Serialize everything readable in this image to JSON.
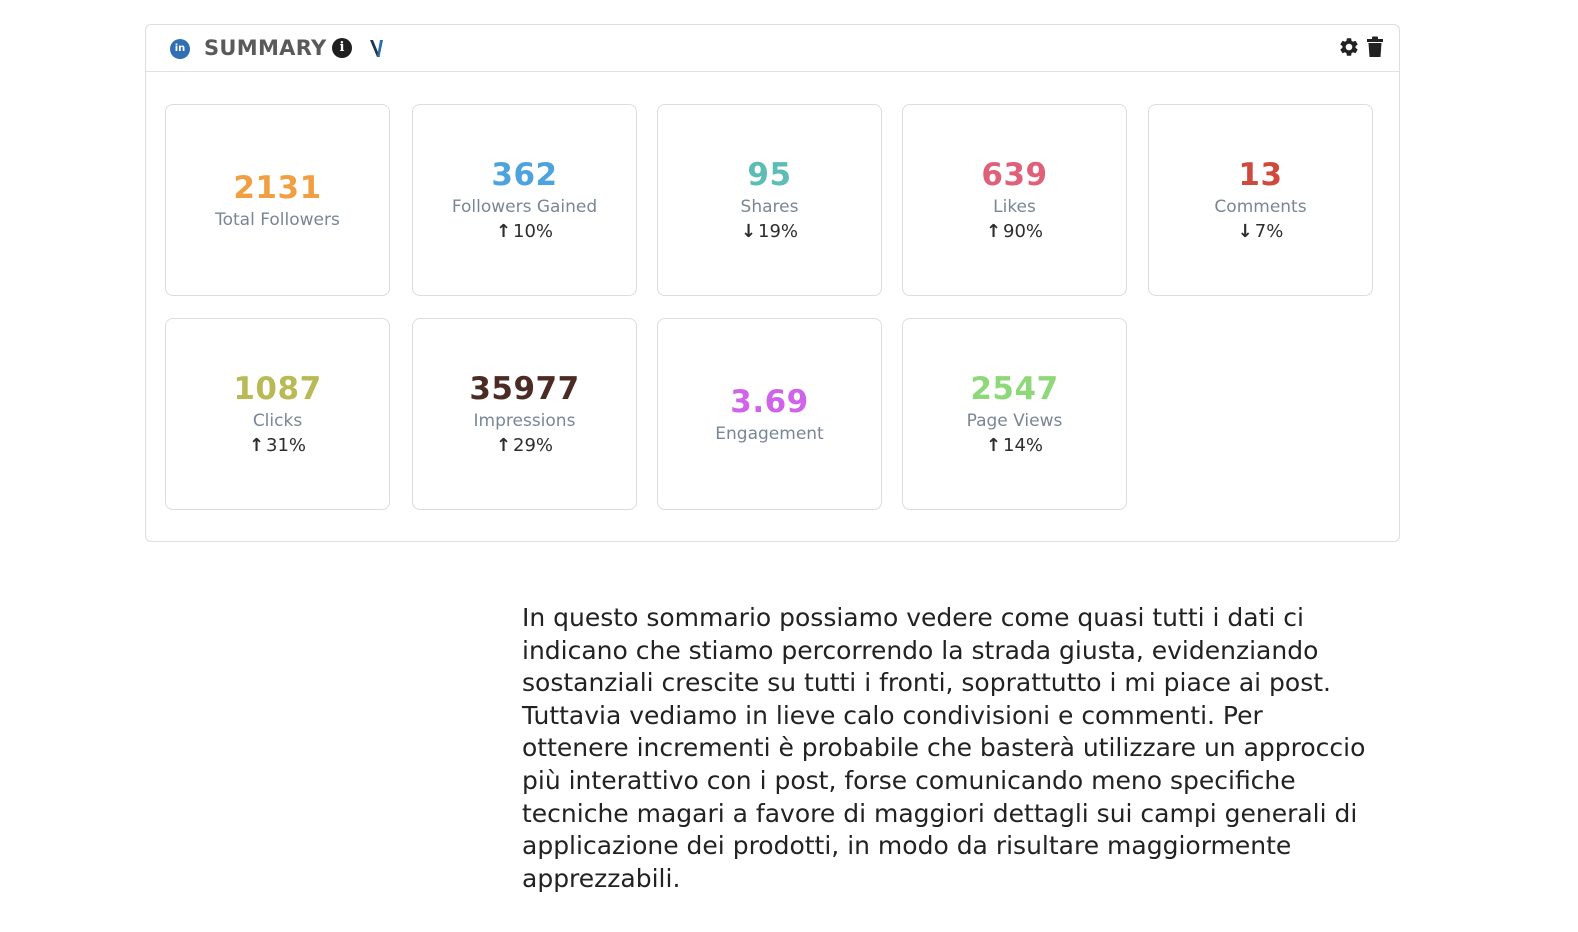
{
  "widget": {
    "network_badge": "in",
    "title": "SUMMARY",
    "info_glyph": "i",
    "icons": [
      "linkedin-icon",
      "info-icon",
      "v-logo-icon",
      "gear-icon",
      "trash-icon"
    ]
  },
  "colors": {
    "total_followers": "#f0a043",
    "followers_gained": "#4da3dd",
    "shares": "#5cbcb6",
    "likes": "#e0607a",
    "comments": "#cf4a3c",
    "clicks": "#b9ba56",
    "impressions": "#4a2c24",
    "engagement": "#cf63ea",
    "page_views": "#8fd87a"
  },
  "metrics": {
    "total_followers": {
      "value": "2131",
      "label": "Total Followers"
    },
    "followers_gained": {
      "value": "362",
      "label": "Followers Gained",
      "arrow": "↑",
      "change": "10%"
    },
    "shares": {
      "value": "95",
      "label": "Shares",
      "arrow": "↓",
      "change": "19%"
    },
    "likes": {
      "value": "639",
      "label": "Likes",
      "arrow": "↑",
      "change": "90%"
    },
    "comments": {
      "value": "13",
      "label": "Comments",
      "arrow": "↓",
      "change": "7%"
    },
    "clicks": {
      "value": "1087",
      "label": "Clicks",
      "arrow": "↑",
      "change": "31%"
    },
    "impressions": {
      "value": "35977",
      "label": "Impressions",
      "arrow": "↑",
      "change": "29%"
    },
    "engagement": {
      "value": "3.69",
      "label": "Engagement"
    },
    "page_views": {
      "value": "2547",
      "label": "Page Views",
      "arrow": "↑",
      "change": "14%"
    }
  },
  "note": {
    "text": "In questo sommario possiamo vedere come quasi tutti i dati ci\nindicano che stiamo percorrendo la strada giusta, evidenziando\nsostanziali crescite su tutti i fronti, soprattutto i mi piace ai post.\nTuttavia vediamo in lieve calo condivisioni e commenti. Per\nottenere incrementi è probabile che basterà utilizzare un approccio\npiù interattivo con i post, forse comunicando meno specifiche\ntecniche magari a favore di maggiori dettagli sui campi generali di\napplicazione dei prodotti, in modo da risultare maggiormente\napprezzabili."
  }
}
